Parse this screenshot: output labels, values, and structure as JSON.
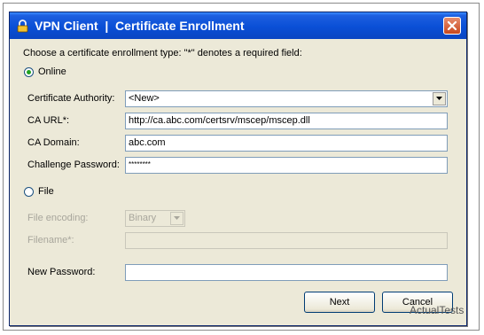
{
  "window": {
    "title": "VPN Client  |  Certificate Enrollment"
  },
  "intro": "Choose a certificate enrollment type:  \"*\" denotes a required field:",
  "online": {
    "label": "Online",
    "selected": true,
    "certificate_authority": {
      "label": "Certificate Authority:",
      "value": "<New>"
    },
    "ca_url": {
      "label": "CA URL*:",
      "value": "http://ca.abc.com/certsrv/mscep/mscep.dll"
    },
    "ca_domain": {
      "label": "CA Domain:",
      "value": "abc.com"
    },
    "challenge_password": {
      "label": "Challenge Password:",
      "value": "********"
    }
  },
  "file": {
    "label": "File",
    "selected": false,
    "file_encoding": {
      "label": "File encoding:",
      "value": "Binary"
    },
    "filename": {
      "label": "Filename*:",
      "value": ""
    }
  },
  "new_password": {
    "label": "New Password:",
    "value": ""
  },
  "buttons": {
    "next": "Next",
    "cancel": "Cancel"
  },
  "watermark": "ActualTests",
  "colors": {
    "title_bar": "#0a4fd6",
    "window_bg": "#ece9d8",
    "close_button": "#c8471e"
  }
}
